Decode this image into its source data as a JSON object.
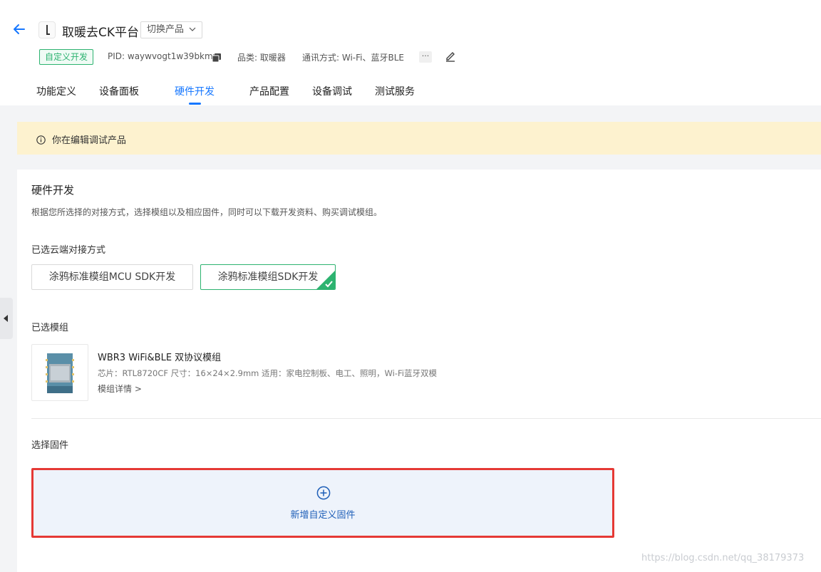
{
  "header": {
    "product_name": "取暖去CK平台",
    "switch_product_label": "切换产品",
    "badge": "自定义开发",
    "pid": "PID: waywvogt1w39bkmw",
    "category": "品类: 取暖器",
    "protocol": "通讯方式: Wi-Fi、蓝牙BLE",
    "more_label": "···"
  },
  "tabs": [
    {
      "label": "功能定义"
    },
    {
      "label": "设备面板"
    },
    {
      "label": "硬件开发"
    },
    {
      "label": "产品配置"
    },
    {
      "label": "设备调试"
    },
    {
      "label": "测试服务"
    }
  ],
  "notice": {
    "text": "你在编辑调试产品"
  },
  "hardware": {
    "title": "硬件开发",
    "description": "根据您所选择的对接方式，选择模组以及相应固件，同时可以下载开发资料、购买调试模组。",
    "cloud_label": "已选云端对接方式",
    "options": [
      {
        "label": "涂鸦标准模组MCU SDK开发",
        "selected": false
      },
      {
        "label": "涂鸦标准模组SDK开发",
        "selected": true
      }
    ],
    "module_label": "已选模组",
    "module": {
      "name": "WBR3 WiFi&BLE 双协议模组",
      "specs": "芯片：RTL8720CF   尺寸：16×24×2.9mm   适用：家电控制板、电工、照明，Wi-Fi蓝牙双模",
      "detail": "模组详情 >"
    },
    "firmware_label": "选择固件",
    "add_firmware_label": "新增自定义固件"
  },
  "watermark": "https://blog.csdn.net/qq_38179373",
  "colors": {
    "accent": "#1677ff",
    "success": "#2db370",
    "notice_bg": "#fdf2cf",
    "highlight_border": "#e53935"
  }
}
